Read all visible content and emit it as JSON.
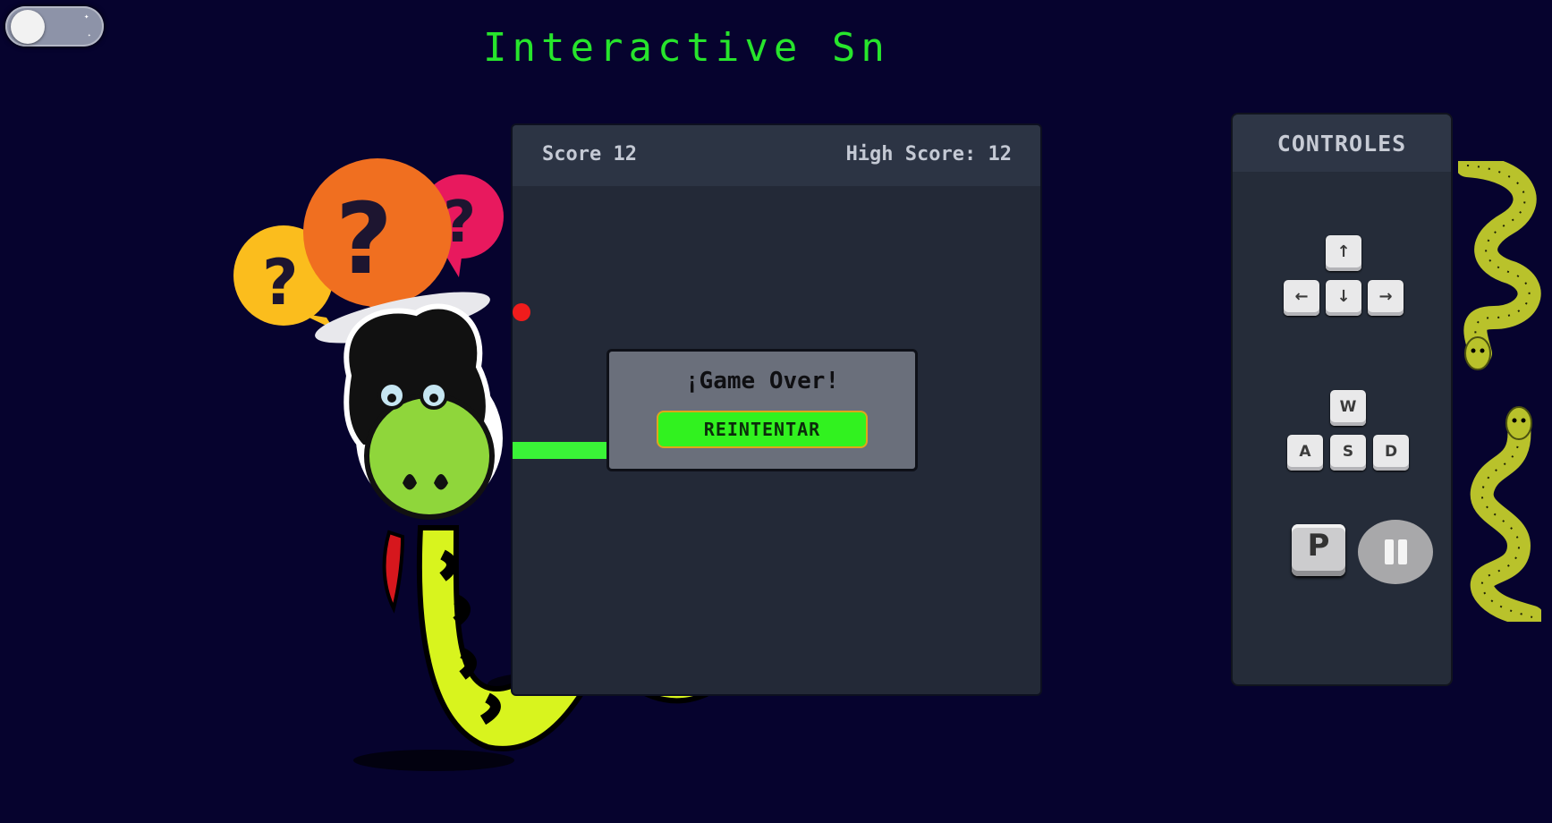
{
  "header": {
    "title": "Interactive Sn"
  },
  "theme_toggle": {
    "state": "dark",
    "knob_icon": "circle-icon",
    "moon_icon": "moon-icon"
  },
  "game": {
    "score_label": "Score 12",
    "high_score_label": "High Score: 12",
    "score": 12,
    "high_score": 12,
    "game_over_title": "¡Game Over!",
    "retry_label": "REINTENTAR",
    "colors": {
      "snake": "#3af437",
      "food": "#f01c1c",
      "board": "#232937",
      "retry_button": "#31f21f"
    }
  },
  "controls": {
    "title": "CONTROLES",
    "arrow_keys": {
      "up": "↑",
      "left": "←",
      "down": "↓",
      "right": "→"
    },
    "wasd_keys": {
      "up": "W",
      "left": "A",
      "down": "S",
      "right": "D"
    },
    "pause_key": "P",
    "pause_icon": "pause-icon"
  },
  "background": {
    "color": "#06032e",
    "illustrations": [
      "confused-snake-illustration",
      "question-bubbles-illustration",
      "green-snake-illustration",
      "green-snake-illustration"
    ]
  }
}
